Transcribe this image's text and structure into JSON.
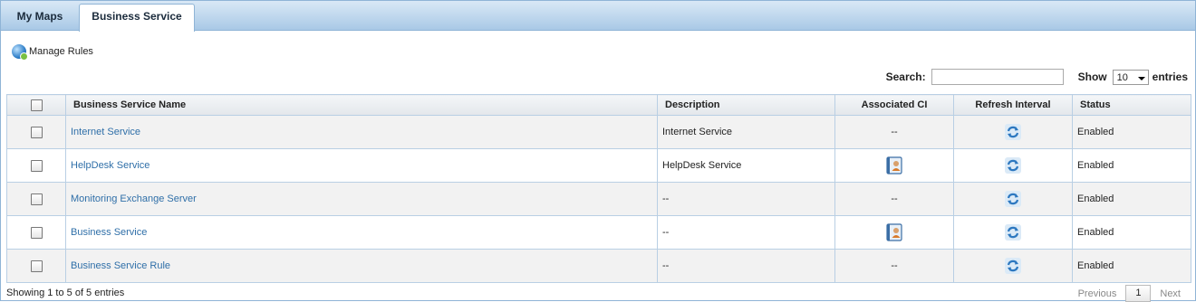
{
  "tabs": [
    {
      "label": "My Maps"
    },
    {
      "label": "Business Service"
    }
  ],
  "toolbar": {
    "manage_rules_label": "Manage Rules"
  },
  "search": {
    "label": "Search:",
    "value": ""
  },
  "length": {
    "show_label": "Show",
    "selected": "10",
    "entries_label": "entries"
  },
  "table": {
    "columns": [
      "Business Service Name",
      "Description",
      "Associated CI",
      "Refresh Interval",
      "Status"
    ],
    "rows": [
      {
        "name": "Internet Service",
        "description": "Internet Service",
        "ci": "--",
        "status": "Enabled"
      },
      {
        "name": "HelpDesk Service",
        "description": "HelpDesk Service",
        "ci": "",
        "status": "Enabled"
      },
      {
        "name": "Monitoring Exchange Server",
        "description": "--",
        "ci": "--",
        "status": "Enabled"
      },
      {
        "name": "Business Service",
        "description": "--",
        "ci": "",
        "status": "Enabled"
      },
      {
        "name": "Business Service Rule",
        "description": "--",
        "ci": "--",
        "status": "Enabled"
      }
    ]
  },
  "footer": {
    "info": "Showing 1 to 5 of 5 entries",
    "previous": "Previous",
    "page": "1",
    "next": "Next"
  },
  "colors": {
    "accent": "#2f6fa8",
    "border": "#b9cfe4",
    "tabbar": "#a9c9e6"
  },
  "icons": {
    "refresh": "refresh-icon",
    "ci": "contact-card-icon",
    "manage_rules": "globe-icon"
  }
}
